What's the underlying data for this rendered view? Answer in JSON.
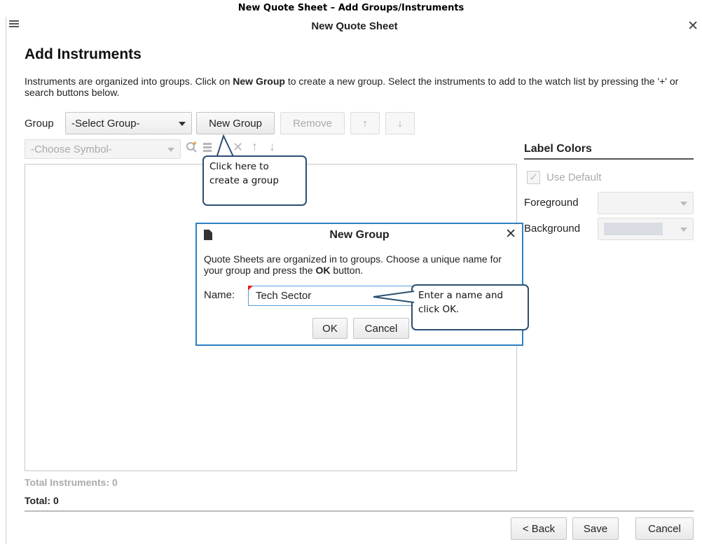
{
  "caption": "New Quote Sheet – Add Groups/Instruments",
  "window": {
    "title": "New Quote Sheet",
    "menu_icon": "hamburger-menu-icon",
    "close_icon": "close-icon",
    "close_glyph": "✕"
  },
  "page": {
    "heading": "Add Instruments",
    "intro_part1": "Instruments are organized into groups.  Click on ",
    "intro_bold": "New Group",
    "intro_part2": " to create a new group.  Select the instruments to add to the watch list by pressing the '+' or search buttons below."
  },
  "group_row": {
    "label": "Group",
    "select_value": "-Select Group-",
    "new_group_label": "New Group",
    "remove_label": "Remove",
    "move_up_icon": "↑",
    "move_down_icon": "↓"
  },
  "symbol_row": {
    "select_placeholder": "-Choose Symbol-",
    "search_icon": "search-plus-icon",
    "list_icon": "list-icon",
    "remove_icon": "✕",
    "up_icon": "↑",
    "down_icon": "↓"
  },
  "totals": {
    "total_instruments": "Total Instruments: 0",
    "total": "Total: 0"
  },
  "label_colors": {
    "title": "Label Colors",
    "use_default": "Use Default",
    "foreground_label": "Foreground",
    "background_label": "Background",
    "background_swatch": "#d9dde3"
  },
  "footer": {
    "back_label": "< Back",
    "save_label": "Save",
    "cancel_label": "Cancel"
  },
  "callouts": {
    "new_group_line1": "Click here to",
    "new_group_line2": "create a group",
    "name_line1": "Enter a name and",
    "name_line2": "click OK."
  },
  "dialog": {
    "title": "New Group",
    "text_part1": "Quote Sheets are organized in to groups.  Choose a unique name for your group and press the ",
    "text_bold": "OK",
    "text_part2": " button.",
    "name_label": "Name:",
    "name_value": "Tech Sector",
    "ok_label": "OK",
    "cancel_label": "Cancel",
    "close_glyph": "✕"
  },
  "colors": {
    "dialog_border": "#2d7fc1",
    "callout_border": "#2c4f70"
  }
}
